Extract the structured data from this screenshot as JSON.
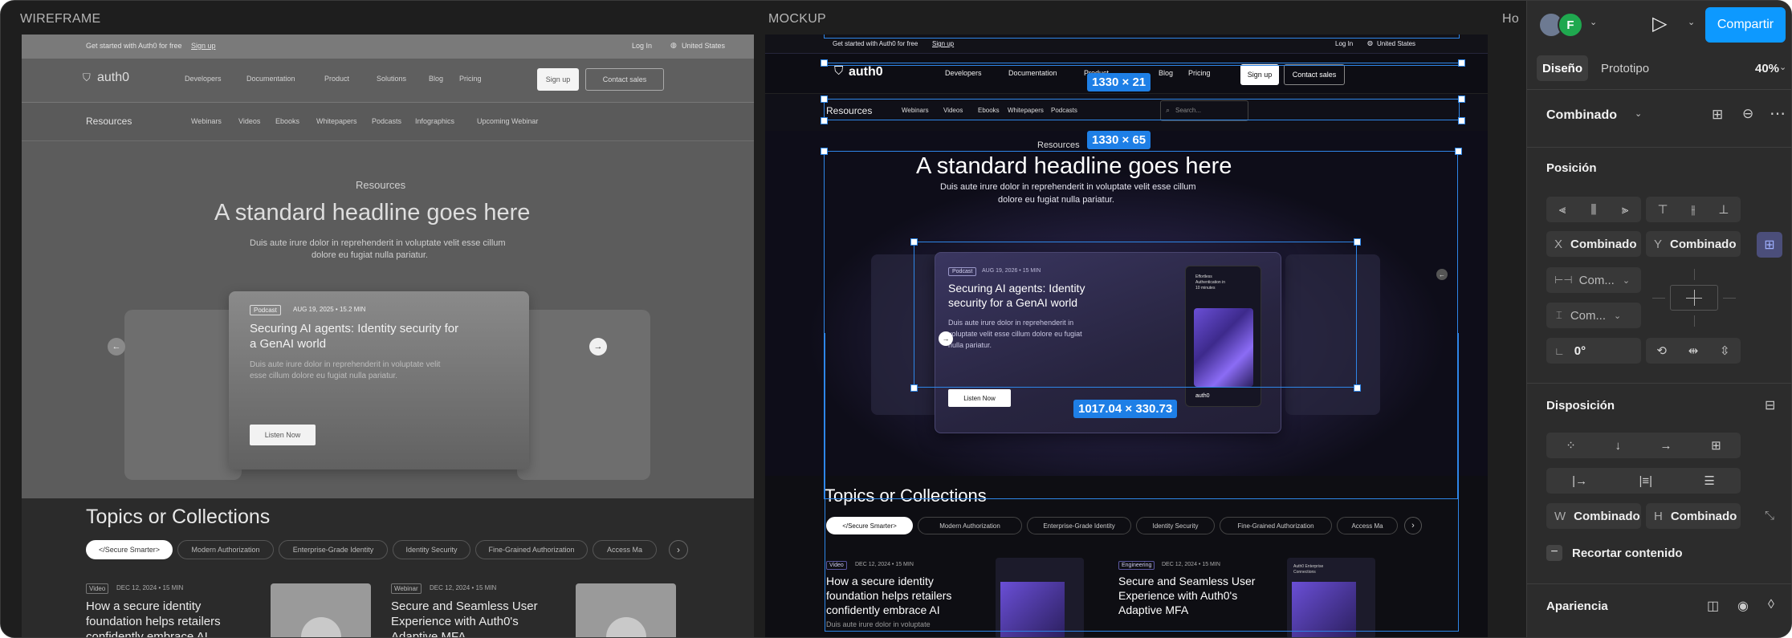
{
  "canvas": {
    "labels": {
      "wireframe": "WIREFRAME",
      "mockup": "MOCKUP",
      "third": "Ho"
    }
  },
  "site": {
    "promo": "Get started with Auth0 for free",
    "promo_link": "Sign up",
    "login": "Log In",
    "region": "United States",
    "brand": "auth0",
    "nav": [
      "Developers",
      "Documentation",
      "Product",
      "Solutions",
      "Blog",
      "Pricing"
    ],
    "signup": "Sign up",
    "contact": "Contact sales",
    "resources_label": "Resources",
    "subnav": [
      "Webinars",
      "Videos",
      "Ebooks",
      "Whitepapers",
      "Podcasts",
      "Infographics",
      "Upcoming Webinar"
    ],
    "search_placeholder": "Search...",
    "eyebrow": "Resources",
    "headline": "A standard headline goes here",
    "intro_1": "Duis aute irure dolor in reprehenderit in voluptate velit esse cillum",
    "intro_2": "dolore eu fugiat nulla pariatur.",
    "card": {
      "tag": "Podcast",
      "meta": "AUG 19, 2025 • 15.2 MIN",
      "meta_mockup": "AUG 19, 2026 • 15 MIN",
      "title_1": "Securing AI agents: Identity security for",
      "title_2": "a GenAI world",
      "title_m1": "Securing AI agents: Identity",
      "title_m2": "security for a GenAI world",
      "body_1": "Duis aute irure dolor in reprehenderit in voluptate velit",
      "body_2": "esse cillum dolore eu fugiat nulla pariatur.",
      "body_m1": "Duis aute irure dolor in reprehenderit in",
      "body_m2": "voluptate velit esse cillum dolore eu fugiat",
      "body_m3": "nulla pariatur.",
      "cta": "Listen Now",
      "tablet_text_1": "Effortless",
      "tablet_text_2": "Authentication in",
      "tablet_text_3": "10 minutes",
      "tablet_brand": "auth0"
    },
    "topics_title": "Topics or Collections",
    "topics": [
      "</Secure Smarter>",
      "Modern Authorization",
      "Enterprise-Grade Identity",
      "Identity Security",
      "Fine-Grained Authorization",
      "Access Ma"
    ],
    "articles": [
      {
        "tag": "Video",
        "meta": "DEC 12, 2024 • 15 MIN",
        "title_1": "How a secure identity",
        "title_2": "foundation helps retailers",
        "title_3": "confidently embrace AI",
        "body": "Duis aute irure dolor in voluptate"
      },
      {
        "tag": "Webinar",
        "tag_mockup": "Engineering",
        "meta": "DEC 12, 2024 • 15 MIN",
        "title_1": "Secure and Seamless User",
        "title_2": "Experience with Auth0's",
        "title_3": "Adaptive MFA",
        "thumb_1": "Auth0 Enterprise",
        "thumb_2": "Connections"
      }
    ]
  },
  "selection": {
    "topbar_size": "1330 × 21",
    "subnav_size": "1330 × 65",
    "card_size": "1017.04 × 330.73"
  },
  "panel": {
    "avatar_initial": "F",
    "share": "Compartir",
    "tabs": [
      "Diseño",
      "Prototipo"
    ],
    "zoom": "40%",
    "layer_name": "Combinado",
    "position_title": "Posición",
    "x_label": "X",
    "x_value": "Combinado",
    "y_label": "Y",
    "y_value": "Combinado",
    "w_short": "Com...",
    "h_short": "Com...",
    "rotation": "0°",
    "layout_title": "Disposición",
    "w_label": "W",
    "w_value": "Combinado",
    "h_label": "H",
    "h_value": "Combinado",
    "clip": "Recortar contenido",
    "appearance_title": "Apariencia",
    "accent": "#0d99ff",
    "avatar_color": "#1fa84f"
  }
}
